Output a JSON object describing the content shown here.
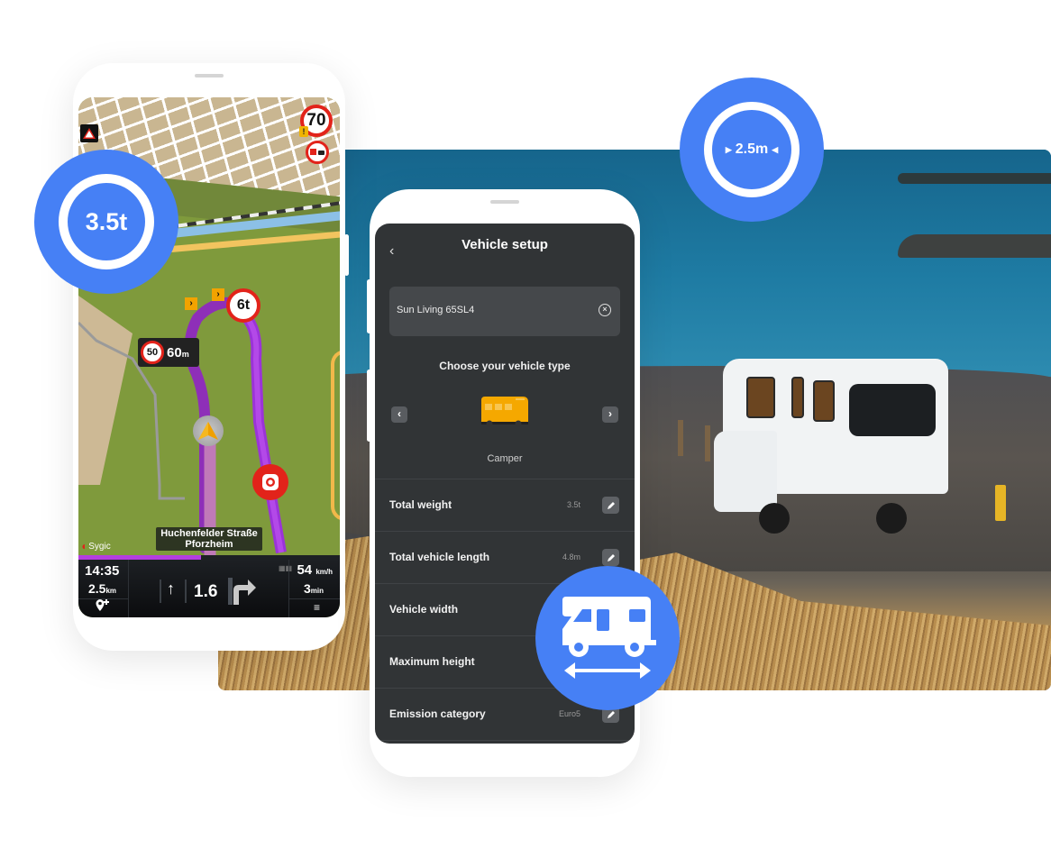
{
  "colors": {
    "badge_blue": "#4680f5",
    "route_purple": "#b43ee0",
    "sign_red": "#e2231a",
    "setup_bg": "#313436",
    "camper_yellow": "#f5a800"
  },
  "badges": {
    "weight": "3.5t",
    "width": "2.5m",
    "camper_icon": "camper-width-icon"
  },
  "map": {
    "speed_limit_sign": "70",
    "weight_limit_sign": "6t",
    "upcoming_speed_limit": "50",
    "upcoming_distance": "60",
    "upcoming_distance_unit": "m",
    "warning_mark": "!",
    "street_line1": "Huchenfelder Straße",
    "street_line2": "Pforzheim",
    "brand": "Sygic",
    "route_progress_percent": 47
  },
  "nav_panel": {
    "time": "14:35",
    "distance_value": "2.5",
    "distance_unit": "km",
    "next_step_distance": "1.6",
    "speed_value": "54",
    "speed_unit": "km/h",
    "eta_value": "3",
    "eta_unit": "min",
    "icons": [
      "add-waypoint-icon",
      "straight-arrow-icon",
      "turn-right-icon",
      "lanes-icon",
      "menu-icon"
    ]
  },
  "vehicle_setup": {
    "title": "Vehicle setup",
    "back_label": "‹",
    "vehicle_name": "Sun Living 65SL4",
    "clear_symbol": "×",
    "choose_label": "Choose your vehicle type",
    "prev_symbol": "‹",
    "next_symbol": "›",
    "selected_type": "Camper",
    "rows": [
      {
        "label": "Total weight",
        "value": "3.5t"
      },
      {
        "label": "Total vehicle length",
        "value": "4.8m"
      },
      {
        "label": "Vehicle width",
        "value": ""
      },
      {
        "label": "Maximum height",
        "value": ""
      },
      {
        "label": "Emission category",
        "value": "Euro5"
      }
    ]
  }
}
